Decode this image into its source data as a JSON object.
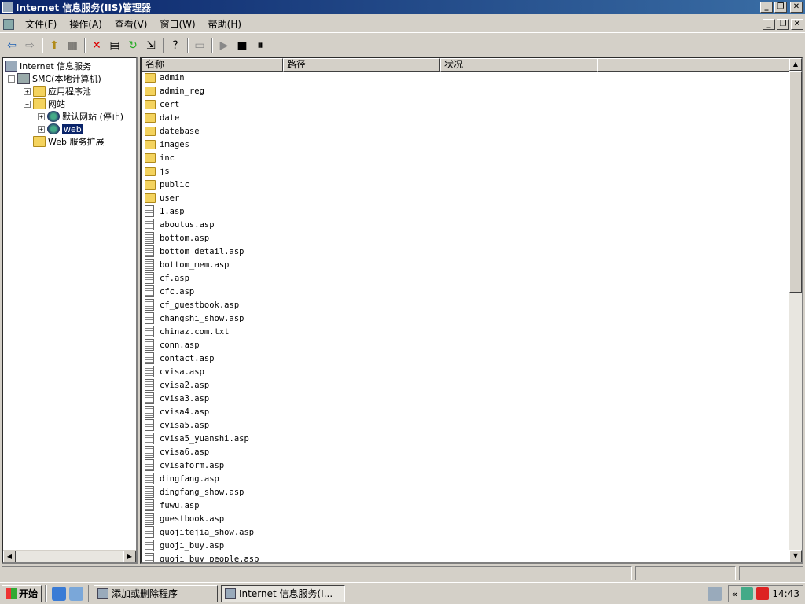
{
  "window": {
    "title": "Internet 信息服务(IIS)管理器"
  },
  "menu": [
    "文件(F)",
    "操作(A)",
    "查看(V)",
    "窗口(W)",
    "帮助(H)"
  ],
  "toolbar": {
    "buttons": [
      "back",
      "forward",
      "up-folder",
      "show-hide-tree",
      "delete",
      "properties",
      "refresh",
      "export-list",
      "help",
      "computer",
      "start",
      "stop",
      "pause"
    ]
  },
  "tree": {
    "root": "Internet 信息服务",
    "computer": "SMC(本地计算机)",
    "app_pools": "应用程序池",
    "websites": "网站",
    "default_site": "默认网站 (停止)",
    "web_site": "web",
    "web_ext": "Web 服务扩展"
  },
  "list": {
    "columns": [
      "名称",
      "路径",
      "状况"
    ],
    "folders": [
      "admin",
      "admin_reg",
      "cert",
      "date",
      "datebase",
      "images",
      "inc",
      "js",
      "public",
      "user"
    ],
    "files": [
      "1.asp",
      "aboutus.asp",
      "bottom.asp",
      "bottom_detail.asp",
      "bottom_mem.asp",
      "cf.asp",
      "cfc.asp",
      "cf_guestbook.asp",
      "changshi_show.asp",
      "chinaz.com.txt",
      "conn.asp",
      "contact.asp",
      "cvisa.asp",
      "cvisa2.asp",
      "cvisa3.asp",
      "cvisa4.asp",
      "cvisa5.asp",
      "cvisa5_yuanshi.asp",
      "cvisa6.asp",
      "cvisaform.asp",
      "dingfang.asp",
      "dingfang_show.asp",
      "fuwu.asp",
      "guestbook.asp",
      "guojitejia_show.asp",
      "guoji_buy.asp",
      "guoji_buy_people.asp"
    ]
  },
  "taskbar": {
    "start": "开始",
    "tasks": [
      "添加或删除程序",
      "Internet 信息服务(I..."
    ],
    "tray_chevron": "«",
    "clock": "14:43"
  }
}
